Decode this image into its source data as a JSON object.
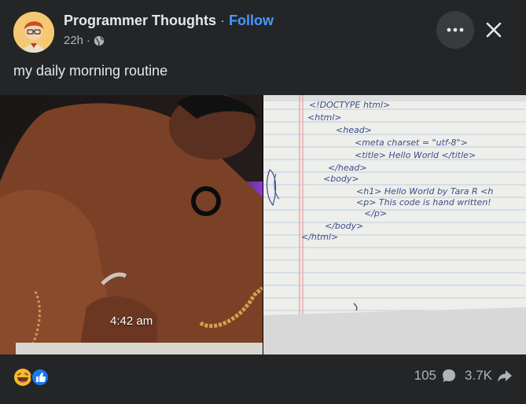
{
  "post": {
    "page_name": "Programmer Thoughts",
    "separator": "·",
    "follow_label": "Follow",
    "time_ago": "22h",
    "meta_separator": "·",
    "caption": "my daily morning routine"
  },
  "media": {
    "left_photo_time": "4:42 am",
    "notebook_lines": [
      "<!DOCTYPE html>",
      "<html>",
      "<head>",
      "<meta charset = \"utf-8\">",
      "<title> Hello World </title>",
      "</head>",
      "<body>",
      "<h1> Hello World by Tara R <h",
      "<p> This code is hand written!",
      "</p>",
      "</body>",
      "</html>"
    ]
  },
  "footer": {
    "comment_count": "105",
    "share_count": "3.7K"
  },
  "colors": {
    "background": "#242526",
    "accent": "#4599ff",
    "secondary_text": "#b0b3b8",
    "like_blue": "#1877f2",
    "haha_yellow": "#f7b928"
  },
  "icons": {
    "globe": "globe-icon",
    "more": "more-horizontal-icon",
    "close": "close-icon",
    "comment": "comment-bubble-icon",
    "share": "share-arrow-icon",
    "haha": "haha-reaction-icon",
    "like": "like-reaction-icon"
  }
}
